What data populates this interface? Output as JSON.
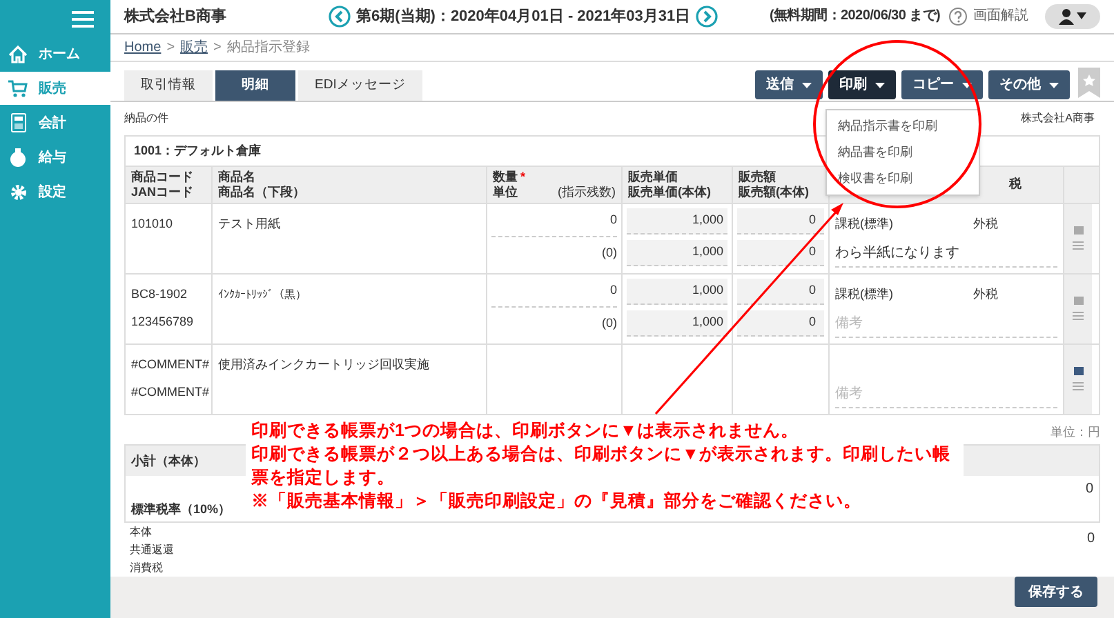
{
  "sidebar": {
    "items": [
      {
        "label": "ホーム",
        "selected": false
      },
      {
        "label": "販売",
        "selected": true
      },
      {
        "label": "会計",
        "selected": false
      },
      {
        "label": "給与",
        "selected": false
      },
      {
        "label": "設定",
        "selected": false
      }
    ]
  },
  "header": {
    "company": "株式会社B商事",
    "period": "第6期(当期)：2020年04月01日 - 2021年03月31日",
    "trial": "(無料期間：2020/06/30 まで)",
    "help": "画面解説"
  },
  "breadcrumb": [
    {
      "label": "Home",
      "link": true
    },
    {
      "label": ">",
      "link": false
    },
    {
      "label": "販売",
      "link": true
    },
    {
      "label": ">",
      "link": false
    },
    {
      "label": "納品指示登録",
      "link": false
    }
  ],
  "required_mark": "*",
  "tabs": [
    {
      "label": "取引情報",
      "selected": false
    },
    {
      "label": "明細",
      "selected": true
    },
    {
      "label": "EDIメッセージ",
      "selected": false
    }
  ],
  "actions": [
    {
      "label": "送信",
      "selected": false
    },
    {
      "label": "印刷",
      "selected": true
    },
    {
      "label": "コピー",
      "selected": false
    },
    {
      "label": "その他",
      "selected": false
    }
  ],
  "print_menu": [
    "納品指示書を印刷",
    "納品書を印刷",
    "検収書を印刷"
  ],
  "subject": "納品の件",
  "customer": "株式会社A商事",
  "warehouse": "1001：デフォルト倉庫",
  "columns": [
    [
      "商品コード",
      "JANコード"
    ],
    [
      "商品名",
      "商品名（下段）"
    ],
    [
      "数量",
      "単位"
    ],
    [
      "販売単価",
      "販売単価(本体)"
    ],
    [
      "販売額",
      "販売額(本体)"
    ],
    [
      "税"
    ]
  ],
  "qty_extra": "(指示残数)",
  "rows": [
    {
      "kind": "item",
      "code": "101010",
      "jan": "",
      "name": "テスト用紙",
      "qty": "0",
      "remaining": "(0)",
      "prices": [
        "1,000",
        "1,000"
      ],
      "amounts": [
        "0",
        "0"
      ],
      "tax": "課税(標準)",
      "tax_mode": "外税",
      "note": "わら半紙になります",
      "note_placeholder": "",
      "marked": false
    },
    {
      "kind": "item",
      "code": "BC8-1902",
      "jan": "123456789",
      "name": "ｲﾝｸｶｰﾄﾘｯｼﾞ（黒）",
      "qty": "0",
      "remaining": "(0)",
      "prices": [
        "1,000",
        "1,000"
      ],
      "amounts": [
        "0",
        "0"
      ],
      "tax": "課税(標準)",
      "tax_mode": "外税",
      "note": "",
      "note_placeholder": "備考",
      "marked": false
    },
    {
      "kind": "comment",
      "code": "#COMMENT#",
      "jan": "#COMMENT#",
      "name": "使用済みインクカートリッジ回収実施",
      "note": "",
      "note_placeholder": "備考",
      "marked": true
    }
  ],
  "summary": {
    "unit": "単位：円",
    "subtotal_label": "小計（本体）",
    "subtotal_value": "0",
    "tax_label": "標準税率（10%）",
    "tax_lines": [
      "本体",
      "共通返還",
      "消費税"
    ],
    "outside_value": "0"
  },
  "annotation": [
    "印刷できる帳票が1つの場合は、印刷ボタンに▼は表示されません。",
    "印刷できる帳票が２つ以上ある場合は、印刷ボタンに▼が表示されます。印刷したい帳票を指定します。",
    "※「販売基本情報」＞「販売印刷設定」の『見積』部分をご確認ください。"
  ],
  "save": "保存する"
}
